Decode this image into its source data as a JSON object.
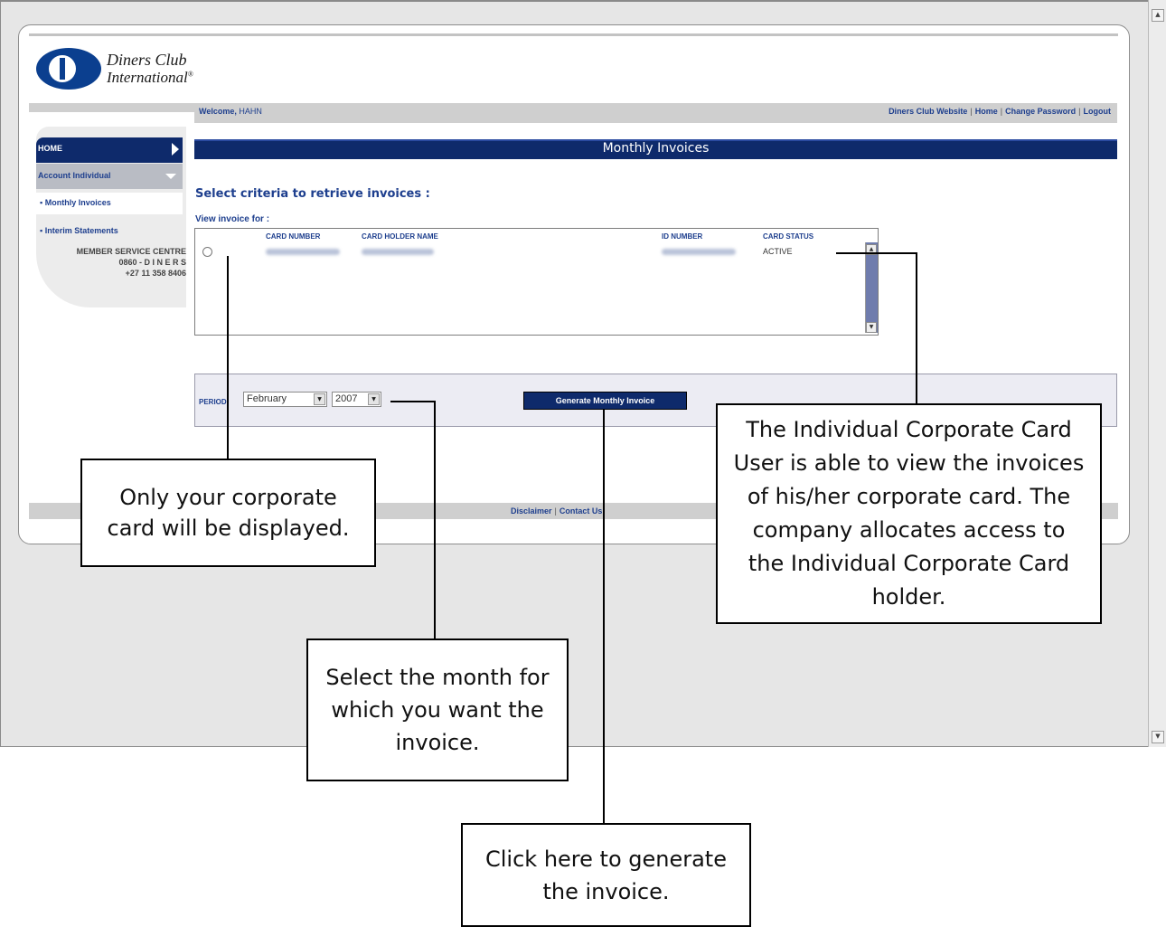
{
  "brand": {
    "line1": "Diners Club",
    "line2": "International",
    "mark": "®"
  },
  "header": {
    "welcome_label": "Welcome,",
    "user": "HAHN",
    "links": [
      "Diners Club Website",
      "Home",
      "Change Password",
      "Logout"
    ]
  },
  "sidebar": {
    "home": "HOME",
    "section": "Account Individual",
    "items": [
      "Monthly Invoices",
      "Interim Statements"
    ],
    "service_centre": {
      "title": "MEMBER SERVICE CENTRE",
      "phone1": "0860 - D I N E R S",
      "phone2": "+27 11 358 8406"
    }
  },
  "main": {
    "title": "Monthly Invoices",
    "criteria": "Select criteria to retrieve invoices :",
    "view_for": "View invoice for :",
    "columns": [
      "CARD NUMBER",
      "CARD HOLDER NAME",
      "ID NUMBER",
      "CARD STATUS"
    ],
    "row_status": "ACTIVE",
    "period_label": "PERIOD:",
    "month": "February",
    "year": "2007",
    "generate_button": "Generate Monthly Invoice"
  },
  "footer": {
    "links": [
      "Disclaimer",
      "Contact Us"
    ]
  },
  "callouts": {
    "card_display": "Only your corporate card will be displayed.",
    "select_month": "Select the month for which you want the invoice.",
    "generate": "Click here to generate the invoice.",
    "individual": "The Individual Corporate Card User is able to view the invoices of his/her corporate card. The company allocates access to the Individual Corporate Card holder."
  },
  "icons": {
    "home_arrow": "triangle-right-icon",
    "section_chevron": "chevron-down-icon",
    "bullet": "bullet-icon"
  },
  "colors": {
    "navy": "#0e2a6b",
    "link_blue": "#1e3f8e",
    "strip_gray": "#cfcfcf"
  }
}
